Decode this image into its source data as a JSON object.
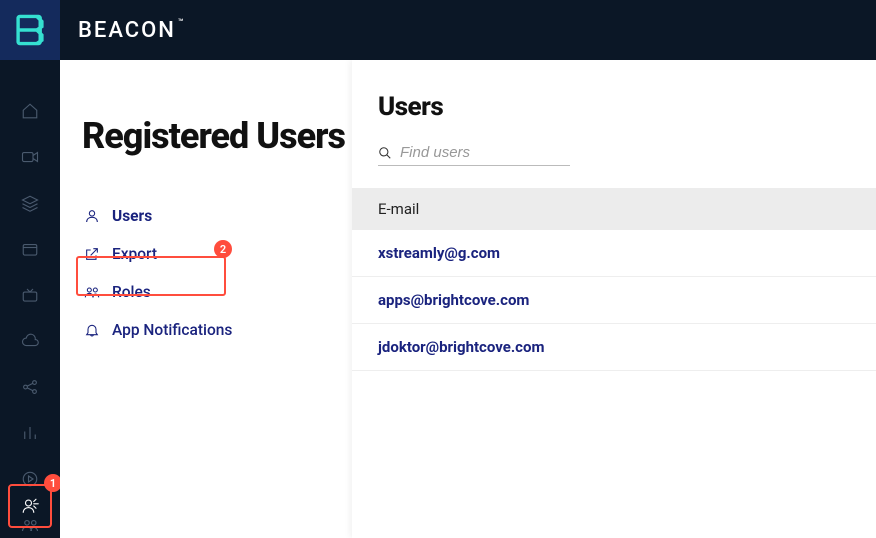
{
  "brand": {
    "name": "BEACON",
    "tm": "™"
  },
  "annotations": {
    "railBadge": "1",
    "menuBadge": "2"
  },
  "panel": {
    "title": "Registered Users",
    "menu": {
      "users": "Users",
      "export": "Export",
      "roles": "Roles",
      "notifications": "App Notifications"
    }
  },
  "main": {
    "title": "Users",
    "searchPlaceholder": "Find users",
    "columnHeader": "E-mail",
    "rows": [
      "xstreamly@g.com",
      "apps@brightcove.com",
      "jdoktor@brightcove.com"
    ]
  }
}
